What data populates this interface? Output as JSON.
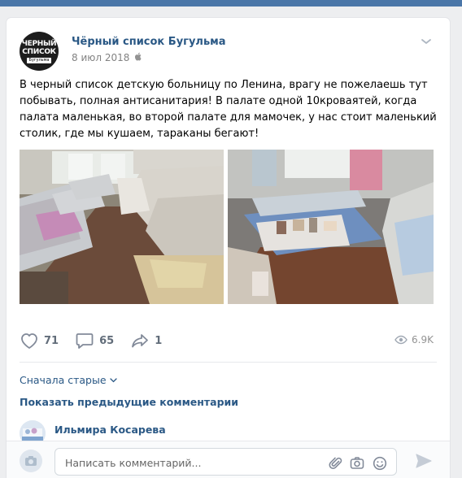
{
  "post": {
    "avatar": {
      "line1": "ЧЕРНЫЙ",
      "line2": "СПИСОК",
      "line3": "Бугульма"
    },
    "author": "Чёрный список Бугульма",
    "date": "8 июл 2018",
    "text": "В черный список детскую больницу по Ленина, врагу не пожелаешь тут побывать, полная антисанитария! В палате одной 10кроваятей, когда палата маленькая, во второй палате для мамочек, у нас стоит маленький столик, где мы кушаем, тараканы бегают!",
    "icons": {
      "more": "chevron-down-icon",
      "platform": "apple-icon"
    }
  },
  "actions": {
    "likes": "71",
    "comments": "65",
    "shares": "1",
    "views": "6.9K",
    "icons": [
      "heart-icon",
      "comment-icon",
      "share-icon",
      "eye-icon"
    ]
  },
  "comments": {
    "sort_label": "Сначала старые",
    "show_previous": "Показать предыдущие комментарии",
    "first_author": "Ильмира Косарева"
  },
  "composer": {
    "placeholder": "Написать комментарий...",
    "icons": [
      "paperclip-icon",
      "camera-icon",
      "emoji-icon",
      "send-icon"
    ]
  },
  "colors": {
    "accent": "#2a5885",
    "header": "#4a76a8",
    "muted": "#828282"
  }
}
